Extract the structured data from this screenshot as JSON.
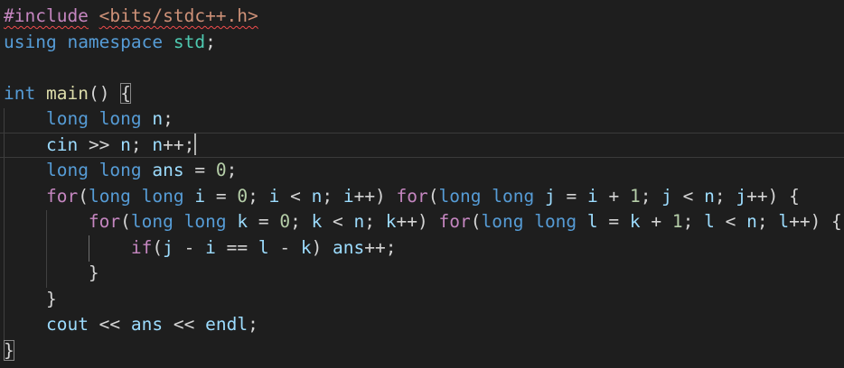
{
  "editor": {
    "colors": {
      "background": "#1e1e1e",
      "keyword": "#569cd6",
      "control": "#c586c0",
      "function": "#dcdcaa",
      "variable": "#9cdcfe",
      "number": "#b5cea8",
      "string": "#ce9178",
      "namespace": "#4ec9b0",
      "error_squiggle": "#f14c4c"
    },
    "lines": [
      [
        [
          "pp",
          "#include"
        ],
        [
          "punc",
          " "
        ],
        [
          "inc",
          "<bits/stdc++.h>"
        ]
      ],
      [
        [
          "kw",
          "using"
        ],
        [
          "punc",
          " "
        ],
        [
          "kw",
          "namespace"
        ],
        [
          "punc",
          " "
        ],
        [
          "ns",
          "std"
        ],
        [
          "punc",
          ";"
        ]
      ],
      [],
      [
        [
          "kw",
          "int"
        ],
        [
          "punc",
          " "
        ],
        [
          "fn",
          "main"
        ],
        [
          "punc",
          "() "
        ],
        [
          "punc",
          "{"
        ]
      ],
      [
        [
          "punc",
          "    "
        ],
        [
          "kw",
          "long"
        ],
        [
          "punc",
          " "
        ],
        [
          "kw",
          "long"
        ],
        [
          "punc",
          " "
        ],
        [
          "var",
          "n"
        ],
        [
          "punc",
          ";"
        ]
      ],
      [
        [
          "punc",
          "    "
        ],
        [
          "var",
          "cin"
        ],
        [
          "punc",
          " >> "
        ],
        [
          "var",
          "n"
        ],
        [
          "punc",
          "; "
        ],
        [
          "var",
          "n"
        ],
        [
          "punc",
          "++;"
        ]
      ],
      [
        [
          "punc",
          "    "
        ],
        [
          "kw",
          "long"
        ],
        [
          "punc",
          " "
        ],
        [
          "kw",
          "long"
        ],
        [
          "punc",
          " "
        ],
        [
          "var",
          "ans"
        ],
        [
          "punc",
          " = "
        ],
        [
          "num",
          "0"
        ],
        [
          "punc",
          ";"
        ]
      ],
      [
        [
          "punc",
          "    "
        ],
        [
          "ctrl",
          "for"
        ],
        [
          "punc",
          "("
        ],
        [
          "kw",
          "long"
        ],
        [
          "punc",
          " "
        ],
        [
          "kw",
          "long"
        ],
        [
          "punc",
          " "
        ],
        [
          "var",
          "i"
        ],
        [
          "punc",
          " = "
        ],
        [
          "num",
          "0"
        ],
        [
          "punc",
          "; "
        ],
        [
          "var",
          "i"
        ],
        [
          "punc",
          " < "
        ],
        [
          "var",
          "n"
        ],
        [
          "punc",
          "; "
        ],
        [
          "var",
          "i"
        ],
        [
          "punc",
          "++) "
        ],
        [
          "ctrl",
          "for"
        ],
        [
          "punc",
          "("
        ],
        [
          "kw",
          "long"
        ],
        [
          "punc",
          " "
        ],
        [
          "kw",
          "long"
        ],
        [
          "punc",
          " "
        ],
        [
          "var",
          "j"
        ],
        [
          "punc",
          " = "
        ],
        [
          "var",
          "i"
        ],
        [
          "punc",
          " + "
        ],
        [
          "num",
          "1"
        ],
        [
          "punc",
          "; "
        ],
        [
          "var",
          "j"
        ],
        [
          "punc",
          " < "
        ],
        [
          "var",
          "n"
        ],
        [
          "punc",
          "; "
        ],
        [
          "var",
          "j"
        ],
        [
          "punc",
          "++) {"
        ]
      ],
      [
        [
          "punc",
          "        "
        ],
        [
          "ctrl",
          "for"
        ],
        [
          "punc",
          "("
        ],
        [
          "kw",
          "long"
        ],
        [
          "punc",
          " "
        ],
        [
          "kw",
          "long"
        ],
        [
          "punc",
          " "
        ],
        [
          "var",
          "k"
        ],
        [
          "punc",
          " = "
        ],
        [
          "num",
          "0"
        ],
        [
          "punc",
          "; "
        ],
        [
          "var",
          "k"
        ],
        [
          "punc",
          " < "
        ],
        [
          "var",
          "n"
        ],
        [
          "punc",
          "; "
        ],
        [
          "var",
          "k"
        ],
        [
          "punc",
          "++) "
        ],
        [
          "ctrl",
          "for"
        ],
        [
          "punc",
          "("
        ],
        [
          "kw",
          "long"
        ],
        [
          "punc",
          " "
        ],
        [
          "kw",
          "long"
        ],
        [
          "punc",
          " "
        ],
        [
          "var",
          "l"
        ],
        [
          "punc",
          " = "
        ],
        [
          "var",
          "k"
        ],
        [
          "punc",
          " + "
        ],
        [
          "num",
          "1"
        ],
        [
          "punc",
          "; "
        ],
        [
          "var",
          "l"
        ],
        [
          "punc",
          " < "
        ],
        [
          "var",
          "n"
        ],
        [
          "punc",
          "; "
        ],
        [
          "var",
          "l"
        ],
        [
          "punc",
          "++) {"
        ]
      ],
      [
        [
          "punc",
          "            "
        ],
        [
          "ctrl",
          "if"
        ],
        [
          "punc",
          "("
        ],
        [
          "var",
          "j"
        ],
        [
          "punc",
          " - "
        ],
        [
          "var",
          "i"
        ],
        [
          "punc",
          " == "
        ],
        [
          "var",
          "l"
        ],
        [
          "punc",
          " - "
        ],
        [
          "var",
          "k"
        ],
        [
          "punc",
          ") "
        ],
        [
          "var",
          "ans"
        ],
        [
          "punc",
          "++;"
        ]
      ],
      [
        [
          "punc",
          "        }"
        ]
      ],
      [
        [
          "punc",
          "    }"
        ]
      ],
      [
        [
          "punc",
          "    "
        ],
        [
          "var",
          "cout"
        ],
        [
          "punc",
          " << "
        ],
        [
          "var",
          "ans"
        ],
        [
          "punc",
          " << "
        ],
        [
          "var",
          "endl"
        ],
        [
          "punc",
          ";"
        ]
      ],
      [
        [
          "punc",
          "}"
        ]
      ]
    ]
  }
}
